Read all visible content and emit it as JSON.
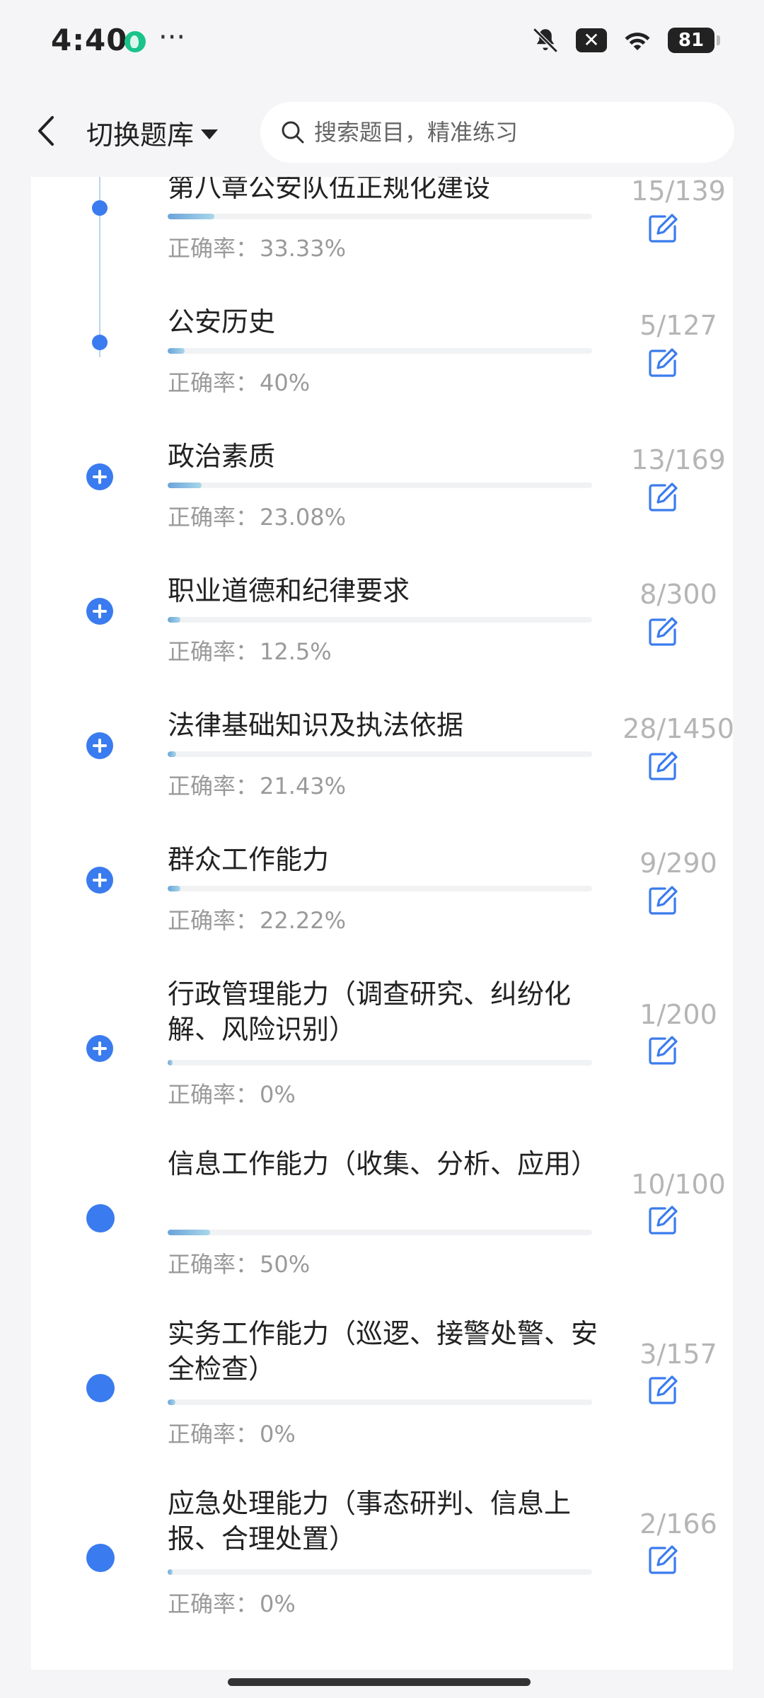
{
  "status_bar": {
    "time": "4:40",
    "battery": "81"
  },
  "header": {
    "bank_label": "切换题库",
    "search_placeholder": "搜索题目，精准练习"
  },
  "accuracy_prefix": "正确率：",
  "chapters": [
    {
      "title": "第八章公安队伍正规化建设",
      "count": "15/139",
      "accuracy": "33.33%",
      "progress": 0.11,
      "node": "dot-small"
    },
    {
      "title": "公安历史",
      "count": "5/127",
      "accuracy": "40%",
      "progress": 0.04,
      "node": "dot-small"
    },
    {
      "title": "政治素质",
      "count": "13/169",
      "accuracy": "23.08%",
      "progress": 0.08,
      "node": "plus"
    },
    {
      "title": "职业道德和纪律要求",
      "count": "8/300",
      "accuracy": "12.5%",
      "progress": 0.03,
      "node": "plus"
    },
    {
      "title": "法律基础知识及执法依据",
      "count": "28/1450",
      "accuracy": "21.43%",
      "progress": 0.02,
      "node": "plus"
    },
    {
      "title": "群众工作能力",
      "count": "9/290",
      "accuracy": "22.22%",
      "progress": 0.03,
      "node": "plus"
    },
    {
      "title": "行政管理能力（调查研究、纠纷化解、风险识别）",
      "count": "1/200",
      "accuracy": "0%",
      "progress": 0.005,
      "node": "plus"
    },
    {
      "title": "信息工作能力（收集、分析、应用）",
      "count": "10/100",
      "accuracy": "50%",
      "progress": 0.1,
      "node": "dot-big"
    },
    {
      "title": "实务工作能力（巡逻、接警处警、安全检查）",
      "count": "3/157",
      "accuracy": "0%",
      "progress": 0.019,
      "node": "dot-big"
    },
    {
      "title": "应急处理能力（事态研判、信息上报、合理处置）",
      "count": "2/166",
      "accuracy": "0%",
      "progress": 0.012,
      "node": "dot-big"
    }
  ]
}
